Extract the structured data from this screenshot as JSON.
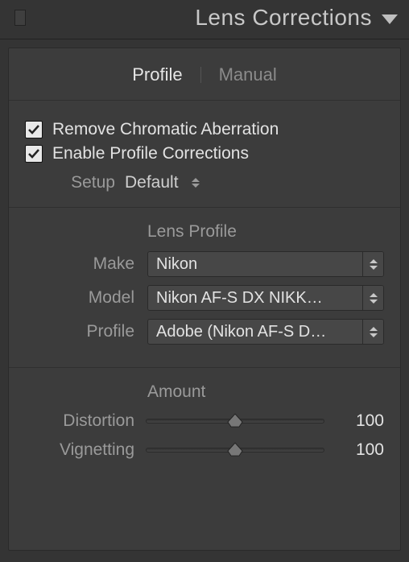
{
  "header": {
    "title": "Lens Corrections"
  },
  "tabs": {
    "profile": "Profile",
    "manual": "Manual",
    "active": "profile"
  },
  "checkboxes": {
    "remove_ca": {
      "label": "Remove Chromatic Aberration",
      "checked": true
    },
    "enable_profile": {
      "label": "Enable Profile Corrections",
      "checked": true
    }
  },
  "setup": {
    "label": "Setup",
    "value": "Default"
  },
  "lens_profile": {
    "heading": "Lens Profile",
    "make": {
      "label": "Make",
      "value": "Nikon"
    },
    "model": {
      "label": "Model",
      "value": "Nikon AF-S DX NIKK…"
    },
    "profile": {
      "label": "Profile",
      "value": "Adobe (Nikon AF-S D…"
    }
  },
  "amount": {
    "heading": "Amount",
    "distortion": {
      "label": "Distortion",
      "value": "100"
    },
    "vignetting": {
      "label": "Vignetting",
      "value": "100"
    }
  }
}
